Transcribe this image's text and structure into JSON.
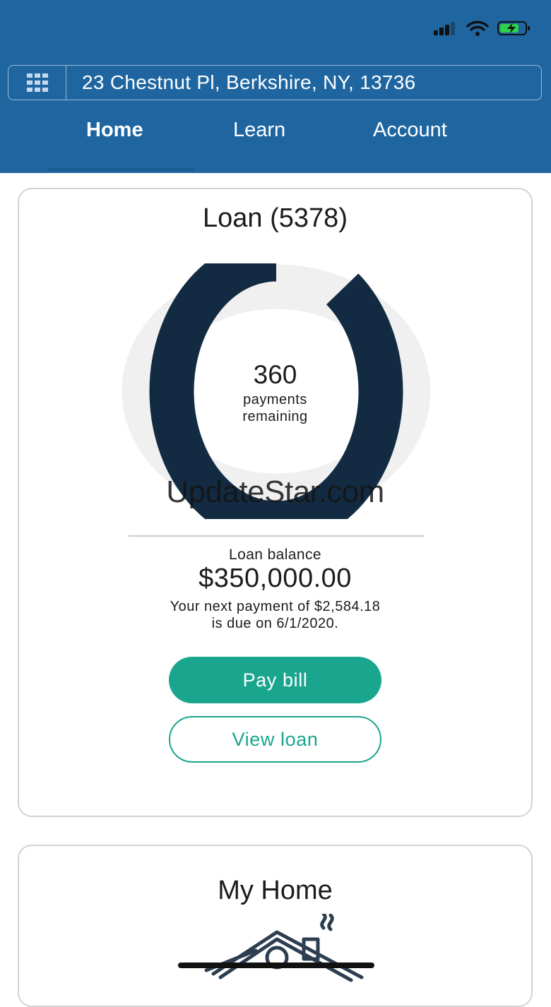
{
  "header": {
    "address": "23 Chestnut Pl, Berkshire, NY, 13736",
    "tabs": [
      {
        "label": "Home",
        "active": true
      },
      {
        "label": "Learn",
        "active": false
      },
      {
        "label": "Account",
        "active": false
      }
    ],
    "background_color": "#1f66a1"
  },
  "status_bar": {
    "icons": [
      "cellular-signal-icon",
      "wifi-icon",
      "battery-charging-icon"
    ]
  },
  "loan_card": {
    "title": "Loan (5378)",
    "payments_remaining": "360",
    "payments_label_line1": "payments",
    "payments_label_line2": "remaining",
    "watermark": "UpdateStar.com",
    "balance_label": "Loan balance",
    "balance_amount": "$350,000.00",
    "next_payment_line1": "Your next payment of $2,584.18",
    "next_payment_line2": "is due on 6/1/2020.",
    "pay_button": "Pay bill",
    "view_button": "View loan",
    "donut": {
      "remaining_fraction": 0.9,
      "remaining_color": "#132b42",
      "paid_color": "#f0f0f0"
    }
  },
  "home_card": {
    "title": "My Home"
  },
  "colors": {
    "accent": "#1aa58e",
    "card_border": "#d3d3d3"
  }
}
